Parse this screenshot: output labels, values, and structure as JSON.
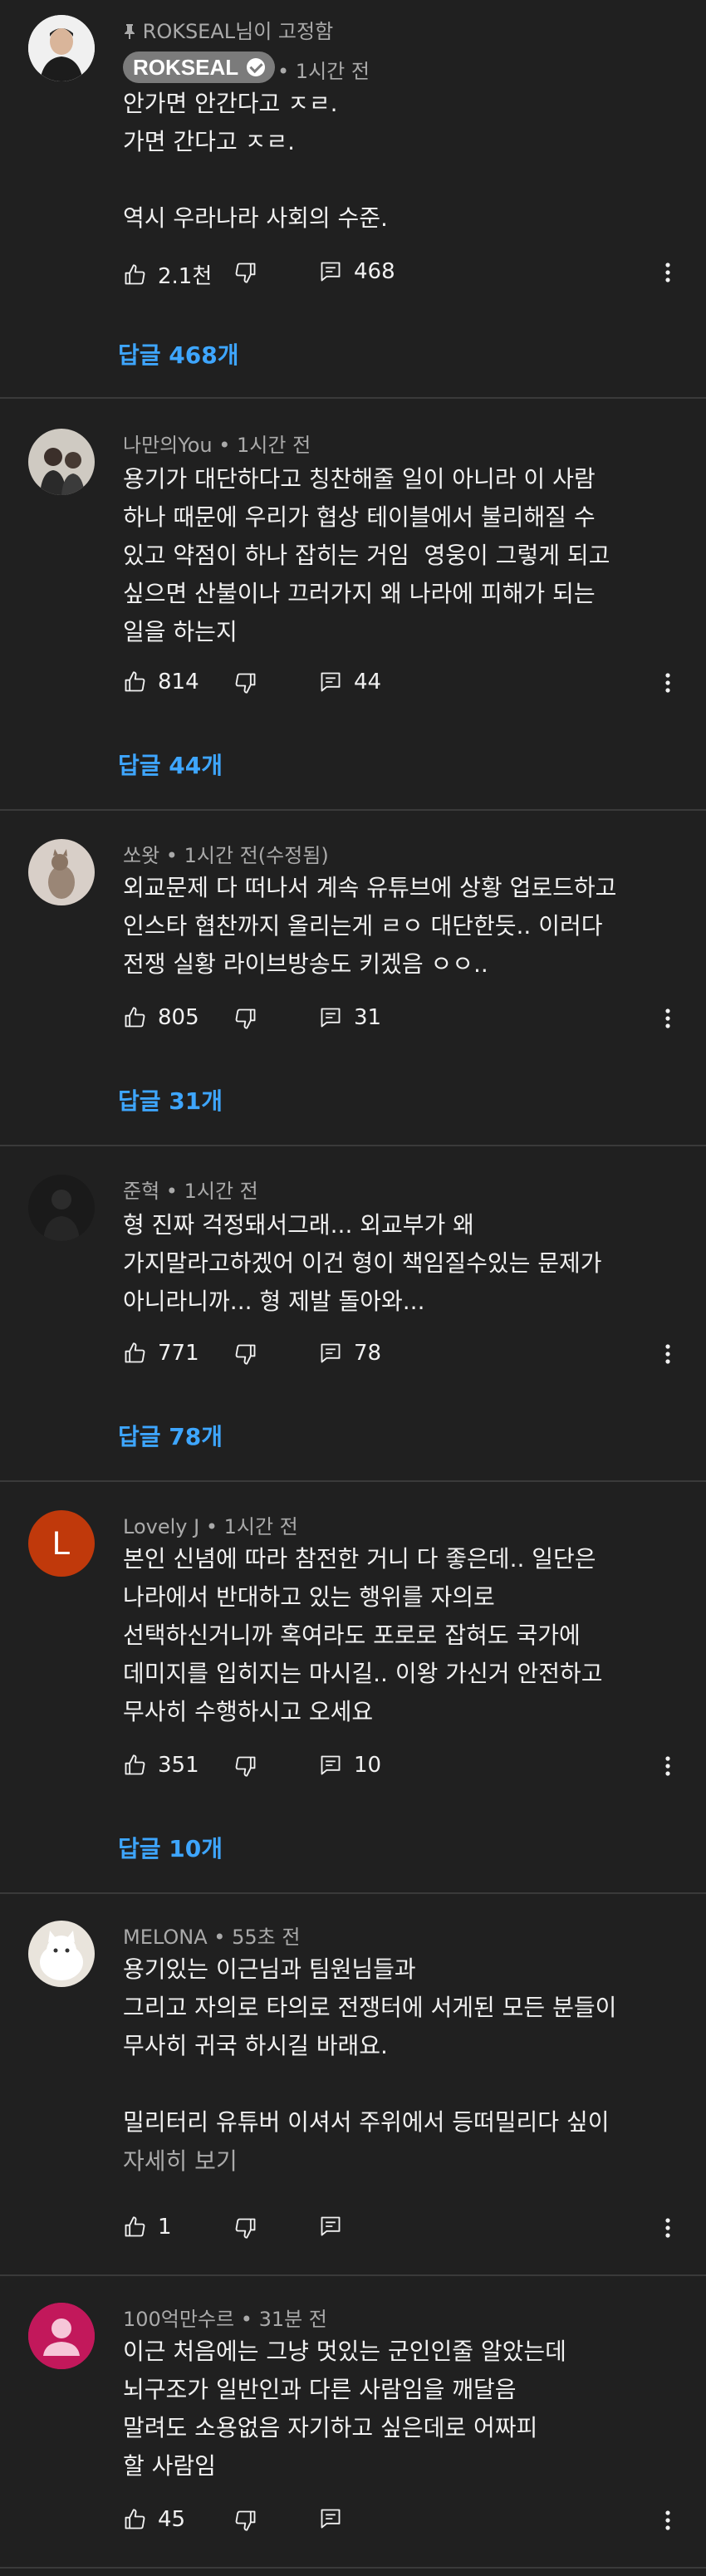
{
  "comments": [
    {
      "pinned_label": "ROKSEAL님이 고정함",
      "author": "ROKSEAL",
      "time": "1시간 전",
      "text": "안가면 안간다고 ㅈㄹ.\n가면 간다고 ㅈㄹ.\n\n역시 우라나라 사회의 수준.",
      "likes": "2.1천",
      "reply_count": "468",
      "replies_label": "답글 468개"
    },
    {
      "author": "나만의You",
      "time": "1시간 전",
      "text": "용기가 대단하다고 칭찬해줄 일이 아니라 이 사람\n하나 때문에 우리가 협상 테이블에서 불리해질 수\n있고 약점이 하나 잡히는 거임  영웅이 그렇게 되고\n싶으면 산불이나 끄러가지 왜 나라에 피해가 되는\n일을 하는지",
      "likes": "814",
      "reply_count": "44",
      "replies_label": "답글 44개"
    },
    {
      "author": "쏘왓",
      "time": "1시간 전(수정됨)",
      "text": "외교문제 다 떠나서 계속 유튜브에 상황 업로드하고\n인스타 협찬까지 올리는게 ㄹㅇ 대단한듯.. 이러다\n전쟁 실황 라이브방송도 키겠음 ㅇㅇ..",
      "likes": "805",
      "reply_count": "31",
      "replies_label": "답글 31개"
    },
    {
      "author": "준혁",
      "time": "1시간 전",
      "text": "형 진짜 걱정돼서그래... 외교부가 왜\n가지말라고하겠어 이건 형이 책임질수있는 문제가\n아니라니까... 형 제발 돌아와...",
      "likes": "771",
      "reply_count": "78",
      "replies_label": "답글 78개"
    },
    {
      "author": "Lovely J",
      "time": "1시간 전",
      "avatar_letter": "L",
      "text": "본인 신념에 따라 참전한 거니 다 좋은데.. 일단은\n나라에서 반대하고 있는 행위를 자의로\n선택하신거니까 혹여라도 포로로 잡혀도 국가에\n데미지를 입히지는 마시길.. 이왕 가신거 안전하고\n무사히 수행하시고 오세요",
      "likes": "351",
      "reply_count": "10",
      "replies_label": "답글 10개"
    },
    {
      "author": "MELONA",
      "time": "55초 전",
      "text": "용기있는 이근님과 팀원님들과\n그리고 자의로 타의로 전쟁터에 서게된 모든 분들이\n무사히 귀국 하시길 바래요.\n\n밀리터리 유튜버 이셔서 주위에서 등떠밀리다 싶이",
      "show_more": "자세히 보기",
      "likes": "1"
    },
    {
      "author": "100억만수르",
      "time": "31분 전",
      "text": "이근 처음에는 그냥 멋있는 군인인줄 알았는데\n뇌구조가 일반인과 다른 사람임을 깨달음\n말려도 소용없음 자기하고 싶은데로 어짜피\n할 사람임",
      "likes": "45"
    }
  ],
  "colors": {
    "background": "#202020",
    "link": "#3ea6ff",
    "meta": "#aaaaaa",
    "avatar_lovely": "#c0390b",
    "avatar_100": "#c2185b"
  },
  "icons": [
    "pin-icon",
    "verified-check-icon",
    "thumbs-up-icon",
    "thumbs-down-icon",
    "reply-icon",
    "more-vert-icon"
  ]
}
